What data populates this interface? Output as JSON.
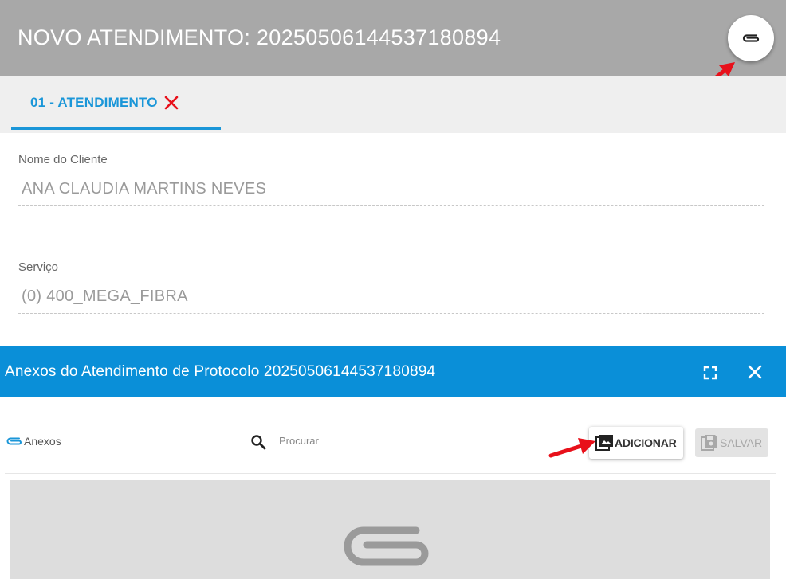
{
  "top_panel": {
    "title": "NOVO ATENDIMENTO: 20250506144537180894",
    "attach_button_icon": "paperclip-icon",
    "tab": {
      "label": "01 - ATENDIMENTO",
      "close_icon": "close-icon"
    },
    "fields": [
      {
        "label": "Nome do Cliente",
        "value": "ANA CLAUDIA MARTINS NEVES"
      },
      {
        "label": "Serviço",
        "value": "(0) 400_MEGA_FIBRA"
      }
    ]
  },
  "dialog": {
    "title": "Anexos do Atendimento de Protocolo 20250506144537180894",
    "expand_icon": "fullscreen-icon",
    "close_icon": "close-icon",
    "section_label": "Anexos",
    "search_placeholder": "Procurar",
    "add_button": "ADICIONAR",
    "save_button": "SALVAR",
    "dropzone_icon": "paperclip-icon"
  },
  "colors": {
    "header_gray": "#a8a8a8",
    "tab_blue": "#1a96d8",
    "dialog_blue": "#0a8fd8",
    "annotation_red": "#e8101a"
  }
}
